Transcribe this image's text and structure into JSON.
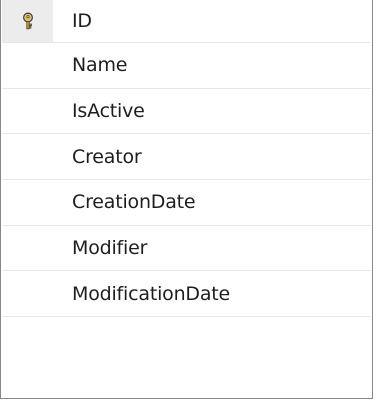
{
  "table": {
    "rows": [
      {
        "label": "ID",
        "is_primary_key": true
      },
      {
        "label": "Name"
      },
      {
        "label": "IsActive"
      },
      {
        "label": "Creator"
      },
      {
        "label": "CreationDate"
      },
      {
        "label": "Modifier"
      },
      {
        "label": "ModificationDate"
      }
    ],
    "primary_key_icon": "key-icon",
    "colors": {
      "border": "#828790",
      "row_divider": "#e7e7e7",
      "first_row_selector": "#ececec",
      "key_gold": "#d6a319"
    }
  }
}
